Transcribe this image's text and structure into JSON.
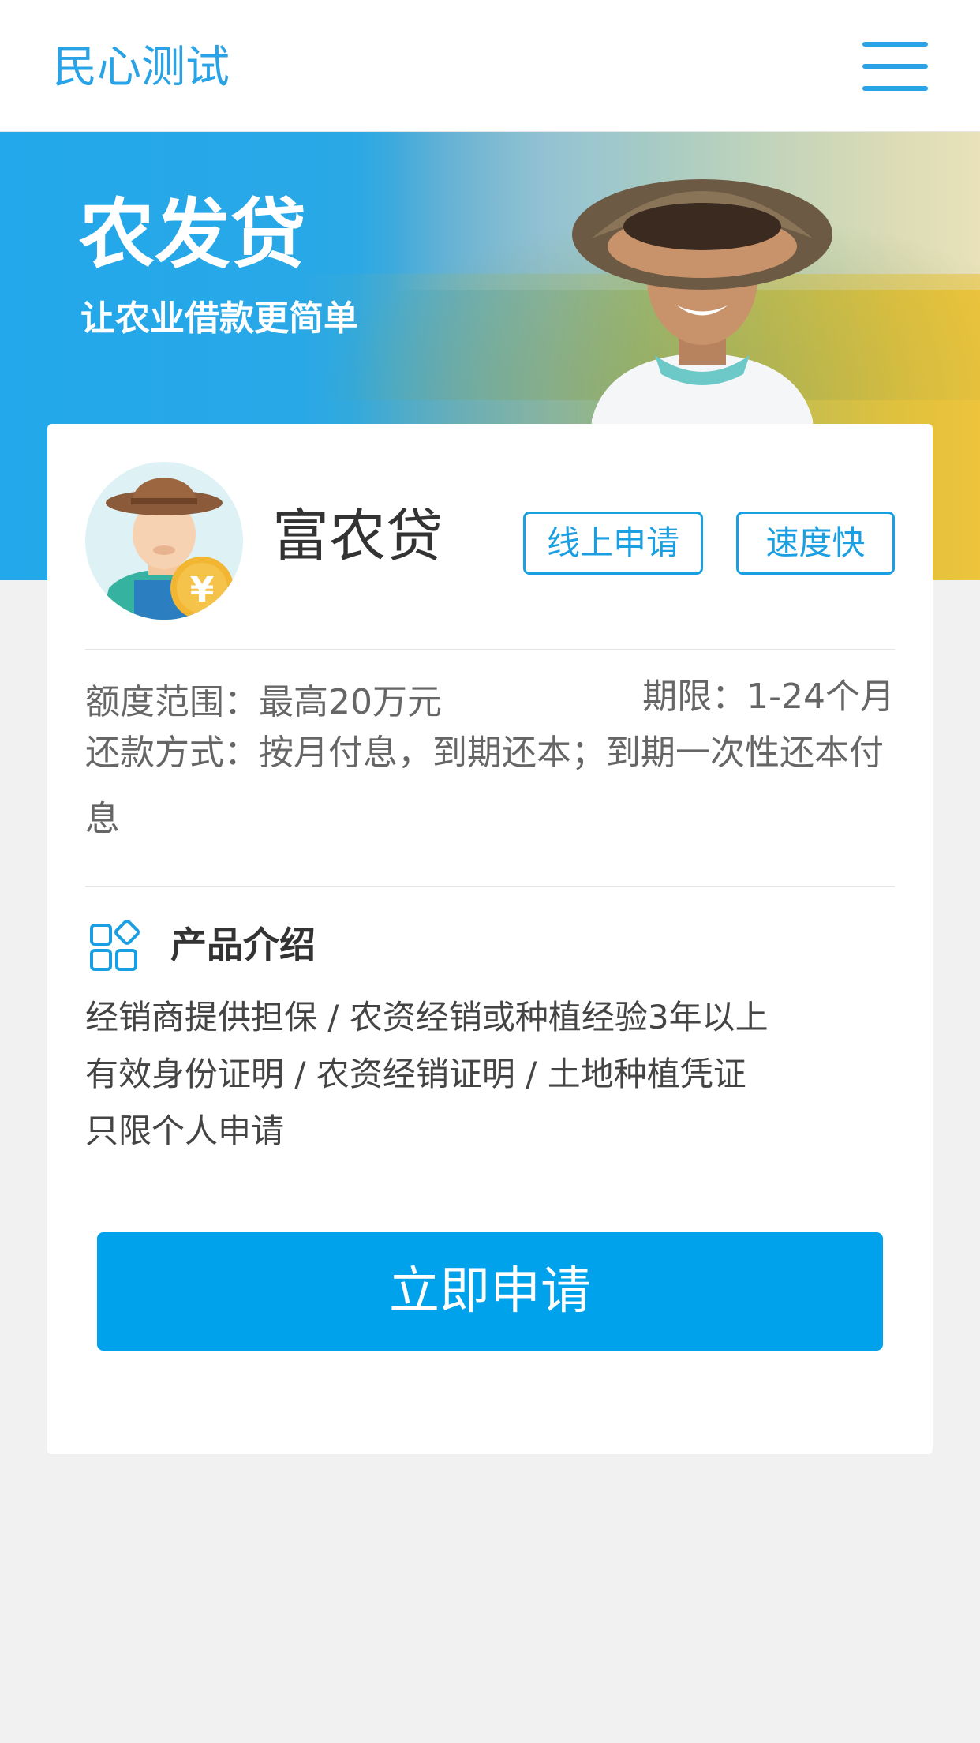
{
  "header": {
    "brand": "民心测试",
    "menu_icon": "hamburger-menu-icon"
  },
  "hero": {
    "title": "农发贷",
    "subtitle": "让农业借款更简单"
  },
  "product": {
    "name": "富农贷",
    "tags": [
      "线上申请",
      "速度快"
    ],
    "amount": "额度范围：最高20万元",
    "term": "期限：1-24个月",
    "repayment": "还款方式：按月付息，到期还本；到期一次性还本付息"
  },
  "intro": {
    "icon": "grid-apps-icon",
    "title": "产品介绍",
    "lines": [
      "经销商提供担保 / 农资经销或种植经验3年以上",
      "有效身份证明 / 农资经销证明 / 土地种植凭证",
      "只限个人申请"
    ]
  },
  "apply_button": "立即申请",
  "colors": {
    "accent": "#1aa0e2",
    "button": "#00a2ec",
    "page_bg": "#f1f1f1"
  }
}
